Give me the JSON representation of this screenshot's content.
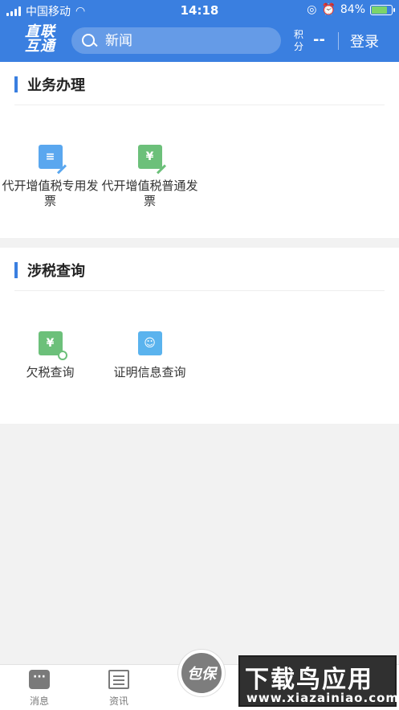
{
  "status_bar": {
    "carrier": "中国移动",
    "time": "14:18",
    "battery": "84%",
    "battery_level": 0.84
  },
  "app_bar": {
    "logo_line1": "直联",
    "logo_line2": "互通",
    "search_placeholder": "新闻",
    "points_label": "积分",
    "points_value": "--",
    "login_label": "登录"
  },
  "sections": [
    {
      "title": "业务办理",
      "items": [
        {
          "label": "代开增值税专用发票",
          "icon": "invoice-special-icon",
          "color": "#5aa7ef"
        },
        {
          "label": "代开增值税普通发票",
          "icon": "invoice-general-icon",
          "color": "#6cc07a"
        }
      ]
    },
    {
      "title": "涉税查询",
      "items": [
        {
          "label": "欠税查询",
          "icon": "tax-arrears-query-icon",
          "color": "#6cc07a"
        },
        {
          "label": "证明信息查询",
          "icon": "certificate-query-icon",
          "color": "#5ab3ee"
        }
      ]
    }
  ],
  "tab_bar": {
    "messages_label": "消息",
    "news_label": "资讯",
    "center_label": "包保"
  },
  "watermark": {
    "text": "下载鸟应用",
    "url": "www.xiazainiao.com"
  },
  "colors": {
    "primary": "#3a7fe0",
    "background": "#f2f2f2"
  }
}
